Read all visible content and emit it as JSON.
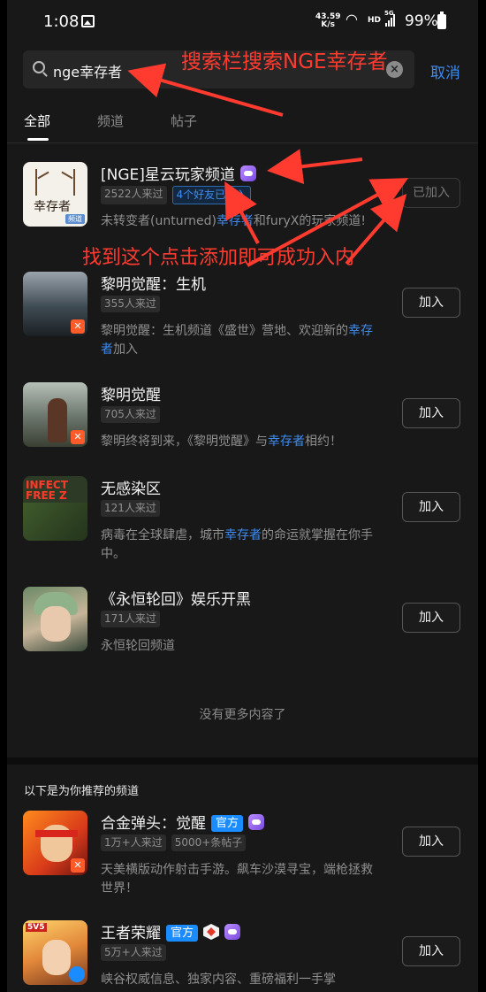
{
  "status_bar": {
    "time": "1:08",
    "net_speed_value": "43.59",
    "net_speed_unit": "K/s",
    "hd": "HD",
    "network": "5G",
    "battery": "99%"
  },
  "search": {
    "query": "nge幸存者",
    "cancel_label": "取消"
  },
  "tabs": [
    {
      "label": "全部"
    },
    {
      "label": "频道"
    },
    {
      "label": "帖子"
    }
  ],
  "results": [
    {
      "title": "[NGE]星云玩家频道",
      "tags": [
        "2522人来过",
        "4个好友已加入"
      ],
      "desc_pre": "未转变者(unturned)",
      "desc_hl": "幸存者",
      "desc_post": "和furyX的玩家频道!",
      "thumb_word": "幸存者",
      "thumb_pill": "频道",
      "button": "已加入"
    },
    {
      "title": "黎明觉醒：生机",
      "tags": [
        "355人来过"
      ],
      "desc_pre": "黎明觉醒：生机频道《盛世》营地、欢迎新的",
      "desc_hl": "幸存者",
      "desc_post": "加入",
      "button": "加入"
    },
    {
      "title": "黎明觉醒",
      "tags": [
        "705人来过"
      ],
      "desc_pre": "黎明终将到来，《黎明觉醒》与",
      "desc_hl": "幸存者",
      "desc_post": "相约！",
      "button": "加入"
    },
    {
      "title": "无感染区",
      "tags": [
        "121人来过"
      ],
      "desc_pre": "病毒在全球肆虐，城市",
      "desc_hl": "幸存者",
      "desc_post": "的命运就掌握在你手中。",
      "thumb_text": "INFECT FREE Z",
      "button": "加入"
    },
    {
      "title": "《永恒轮回》娱乐开黑",
      "tags": [
        "171人来过"
      ],
      "desc_pre": "永恒轮回频道",
      "desc_hl": "",
      "desc_post": "",
      "button": "加入"
    }
  ],
  "no_more_label": "没有更多内容了",
  "recommend": {
    "section_title": "以下是为你推荐的频道",
    "items": [
      {
        "title": "合金弹头：觉醒",
        "official": "官方",
        "tags": [
          "1万+人来过",
          "5000+条帖子"
        ],
        "desc": "天美横版动作射击手游。飙车沙漠寻宝，端枪拯救世界！",
        "button": "加入"
      },
      {
        "title": "王者荣耀",
        "official": "官方",
        "tags": [
          "5万+人来过"
        ],
        "desc": "峡谷权威信息、独家内容、重磅福利一手掌",
        "thumb_label": "5V5",
        "button": "加入"
      }
    ]
  },
  "annotations": {
    "top": "搜索栏搜索NGE幸存者",
    "middle": "找到这个点击添加即可成功入内",
    "color": "#ff3b30"
  },
  "colors": {
    "accent": "#3d8bf0",
    "background": "#181818",
    "official_badge": "#1a8cff"
  }
}
